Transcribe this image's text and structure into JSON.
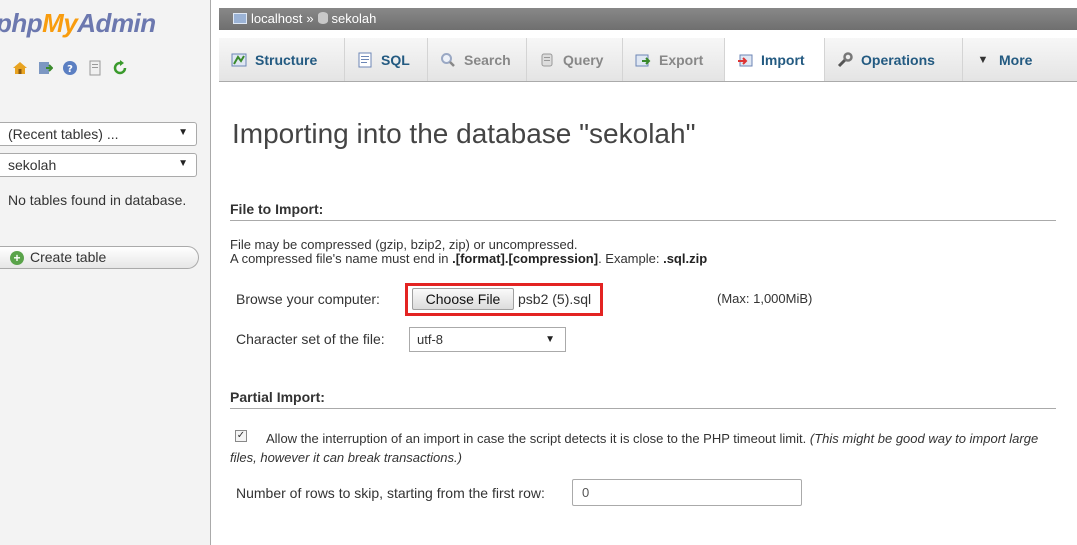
{
  "sidebar": {
    "logo": {
      "php": "php",
      "my": "My",
      "admin": "Admin"
    },
    "nav_icons": [
      "home-icon",
      "logout-icon",
      "help-icon",
      "docs-icon",
      "reload-icon"
    ],
    "recent_tables": "(Recent tables) ...",
    "database_select": "sekolah",
    "no_tables": "No tables found in database.",
    "create_table": "Create table"
  },
  "breadcrumb": {
    "server": "localhost",
    "separator": "»",
    "database": "sekolah"
  },
  "tabs": [
    {
      "label": "Structure",
      "icon": "structure-icon"
    },
    {
      "label": "SQL",
      "icon": "sql-icon"
    },
    {
      "label": "Search",
      "icon": "search-icon"
    },
    {
      "label": "Query",
      "icon": "query-icon"
    },
    {
      "label": "Export",
      "icon": "export-icon"
    },
    {
      "label": "Import",
      "icon": "import-icon"
    },
    {
      "label": "Operations",
      "icon": "operations-icon"
    },
    {
      "label": "More",
      "icon": "more-arrow-icon"
    }
  ],
  "active_tab": "Import",
  "main": {
    "title": "Importing into the database \"sekolah\"",
    "file_section": {
      "heading": "File to Import:",
      "desc_line1": "File may be compressed (gzip, bzip2, zip) or uncompressed.",
      "desc_line2_prefix": "A compressed file's name must end in ",
      "desc_line2_bold": ".[format].[compression]",
      "desc_line2_mid": ". Example: ",
      "desc_line2_example": ".sql.zip",
      "browse_label": "Browse your computer:",
      "choose_button": "Choose File",
      "file_name": "psb2 (5).sql",
      "max_size": "(Max: 1,000MiB)",
      "charset_label": "Character set of the file:",
      "charset_value": "utf-8"
    },
    "partial_section": {
      "heading": "Partial Import:",
      "checkbox_checked": true,
      "allow_text": "Allow the interruption of an import in case the script detects it is close to the PHP timeout limit.",
      "allow_note": "(This might be good way to import large files, however it can break transactions.)",
      "skip_label": "Number of rows to skip, starting from the first row:",
      "skip_value": "0"
    }
  },
  "colors": {
    "highlight": "#e32322",
    "link": "#235a81",
    "logo_blue": "#6c78af",
    "logo_orange": "#f89c0e"
  }
}
